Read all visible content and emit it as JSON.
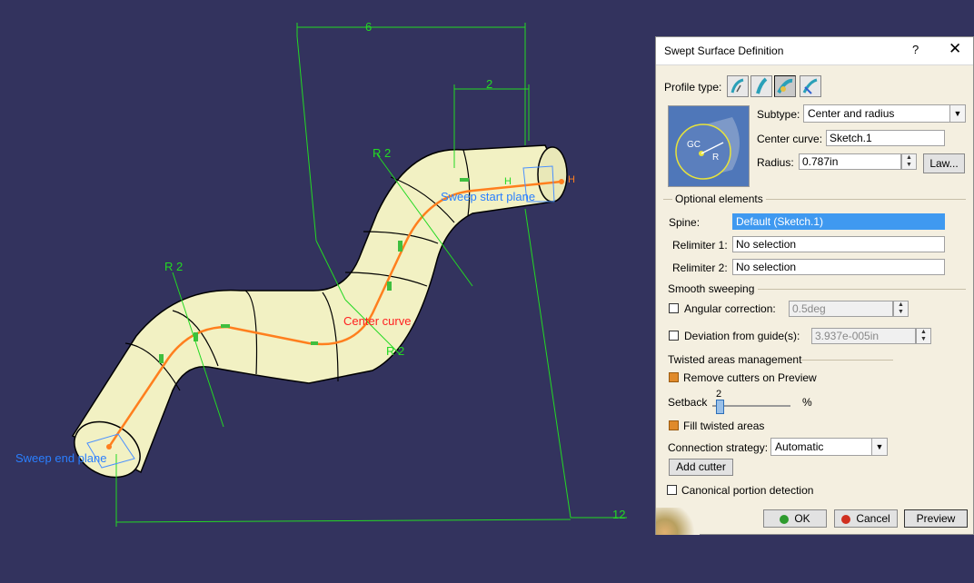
{
  "viewport": {
    "dim_top": "6",
    "dim_small": "2",
    "dim_bottom": "12",
    "radius_top": "R 2",
    "radius_left": "R 2",
    "radius_mid": "R 2",
    "label_center_curve": "Center curve",
    "label_start_plane": "Sweep start plane",
    "label_end_plane": "Sweep end plane",
    "constraint_h1": "H",
    "constraint_h2": "H"
  },
  "dialog": {
    "title": "Swept Surface Definition",
    "help_label": "?",
    "close_label": "✕",
    "profile_type_label": "Profile type:",
    "profile_types": [
      "explicit-profile-icon",
      "line-profile-icon",
      "circle-profile-icon",
      "conic-profile-icon"
    ],
    "preview_gc": "GC",
    "preview_r": "R",
    "subtype_label": "Subtype:",
    "subtype_value": "Center and radius",
    "center_curve_label": "Center curve:",
    "center_curve_value": "Sketch.1",
    "radius_label": "Radius:",
    "radius_value": "0.787in",
    "law_button": "Law...",
    "optional_elements": "Optional elements",
    "spine_label": "Spine:",
    "spine_value": "Default (Sketch.1)",
    "relimiter1_label": "Relimiter 1:",
    "relimiter1_value": "No selection",
    "relimiter2_label": "Relimiter 2:",
    "relimiter2_value": "No selection",
    "smooth_sweeping": "Smooth sweeping",
    "angular_label": "Angular correction:",
    "angular_value": "0.5deg",
    "angular_checked": false,
    "deviation_label": "Deviation from guide(s):",
    "deviation_value": "3.937e-005in",
    "deviation_checked": false,
    "twisted_areas": "Twisted areas management",
    "remove_cutters_label": "Remove cutters on Preview",
    "remove_cutters_checked": true,
    "setback_label": "Setback",
    "setback_value": "2",
    "setback_unit": "%",
    "setback_fraction": 0.05,
    "fill_twisted_label": "Fill twisted areas",
    "fill_twisted_checked": true,
    "connection_label": "Connection strategy:",
    "connection_value": "Automatic",
    "add_cutter_button": "Add cutter",
    "canonical_label": "Canonical portion detection",
    "canonical_checked": false,
    "ok_button": "OK",
    "cancel_button": "Cancel",
    "preview_button": "Preview"
  },
  "colors": {
    "background": "#33335e",
    "tube": "#f2f1c3",
    "curve": "#ff7f1e",
    "dimension": "#23d923",
    "label_blue": "#2a7fff",
    "label_red": "#ff2020",
    "dialog_bg": "#f4efe0",
    "selection": "#3f99f0"
  }
}
